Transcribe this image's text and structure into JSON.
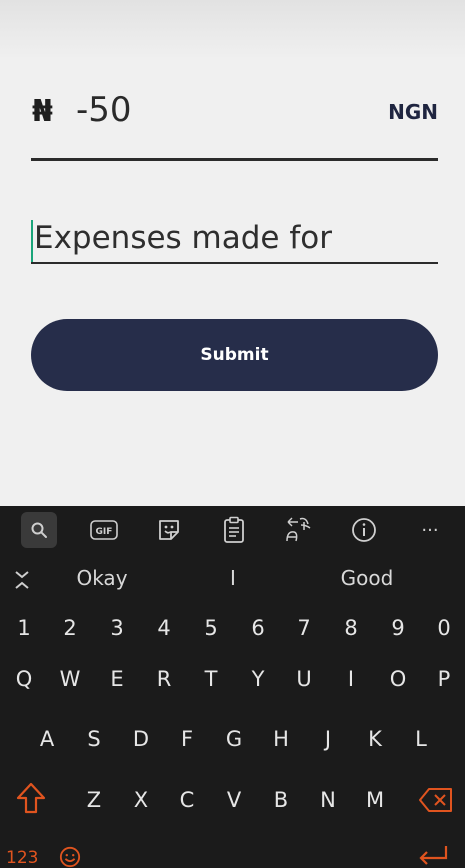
{
  "form": {
    "currency_symbol": "₦",
    "amount": "-50",
    "currency_code": "NGN",
    "description_value": "Expenses made for",
    "submit_label": "Submit"
  },
  "keyboard": {
    "toolbar": [
      "search-icon",
      "gif-icon",
      "sticker-icon",
      "clipboard-icon",
      "translate-icon",
      "info-icon",
      "more-icon"
    ],
    "toolbar_labels": {
      "gif": "GIF",
      "more": "···"
    },
    "suggestions": [
      "Okay",
      "I",
      "Good"
    ],
    "row_numbers": [
      "1",
      "2",
      "3",
      "4",
      "5",
      "6",
      "7",
      "8",
      "9",
      "0"
    ],
    "row_top": [
      "Q",
      "W",
      "E",
      "R",
      "T",
      "Y",
      "U",
      "I",
      "O",
      "P"
    ],
    "row_middle": [
      "A",
      "S",
      "D",
      "F",
      "G",
      "H",
      "J",
      "K",
      "L"
    ],
    "row_bottom": [
      "Z",
      "X",
      "C",
      "V",
      "B",
      "N",
      "M"
    ],
    "symbols_label": "123",
    "accent_color": "#e0541f"
  },
  "colors": {
    "button_bg": "#262d4a",
    "caret": "#1aa57a"
  }
}
